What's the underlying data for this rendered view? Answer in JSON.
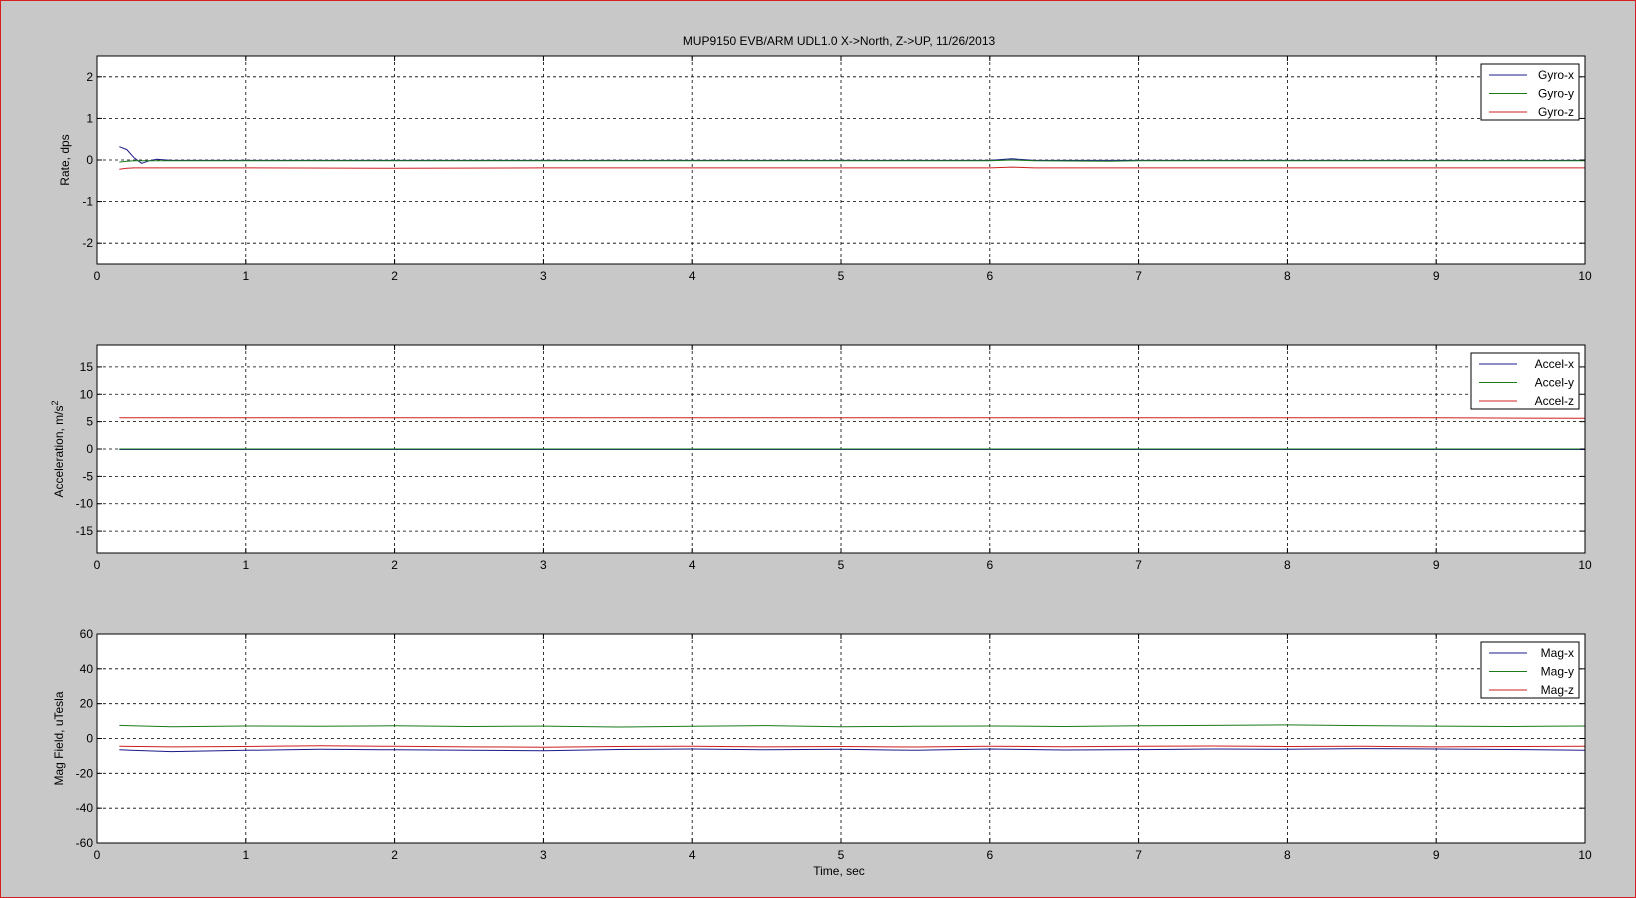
{
  "figure": {
    "title": "MUP9150 EVB/ARM UDL1.0 X->North, Z->UP, 11/26/2013",
    "xlabel": "Time, sec"
  },
  "colors": {
    "background": "#c8c8c8",
    "axes_background": "#ffffff",
    "x_series": "#1a1a8c",
    "y_series": "#1a7a1a",
    "z_series": "#cc2020",
    "window_border": "#d42020"
  },
  "chart_data": [
    {
      "type": "line",
      "ylabel": "Rate, dps",
      "xlim": [
        0,
        10
      ],
      "ylim": [
        -2.5,
        2.5
      ],
      "xticks": [
        0,
        1,
        2,
        3,
        4,
        5,
        6,
        7,
        8,
        9,
        10
      ],
      "yticks": [
        -2,
        -1,
        0,
        1,
        2
      ],
      "grid": true,
      "legend_position": "top-right",
      "x": [
        0.15,
        0.2,
        0.25,
        0.3,
        0.35,
        0.4,
        0.5,
        1.0,
        2.0,
        3.0,
        4.0,
        5.0,
        6.0,
        6.15,
        6.3,
        6.8,
        7.0,
        8.0,
        9.0,
        10.0
      ],
      "series": [
        {
          "name": "Gyro-x",
          "color": "#1a1a8c",
          "values": [
            0.32,
            0.25,
            0.05,
            -0.08,
            -0.02,
            0.02,
            -0.01,
            -0.01,
            -0.01,
            -0.01,
            -0.01,
            -0.01,
            -0.01,
            0.03,
            -0.01,
            -0.01,
            -0.01,
            -0.01,
            -0.01,
            -0.01
          ]
        },
        {
          "name": "Gyro-y",
          "color": "#1a7a1a",
          "values": [
            -0.05,
            -0.03,
            -0.02,
            -0.02,
            -0.02,
            -0.02,
            -0.02,
            -0.02,
            -0.02,
            -0.02,
            -0.02,
            -0.02,
            -0.02,
            0.0,
            -0.02,
            -0.03,
            -0.02,
            -0.02,
            -0.02,
            -0.02
          ]
        },
        {
          "name": "Gyro-z",
          "color": "#cc2020",
          "values": [
            -0.22,
            -0.2,
            -0.19,
            -0.19,
            -0.19,
            -0.19,
            -0.19,
            -0.19,
            -0.2,
            -0.19,
            -0.19,
            -0.19,
            -0.19,
            -0.17,
            -0.19,
            -0.19,
            -0.19,
            -0.19,
            -0.19,
            -0.19
          ]
        }
      ]
    },
    {
      "type": "line",
      "ylabel": "Acceleration, m/s",
      "ylabel_superscript": "2",
      "xlim": [
        0,
        10
      ],
      "ylim": [
        -19,
        19
      ],
      "xticks": [
        0,
        1,
        2,
        3,
        4,
        5,
        6,
        7,
        8,
        9,
        10
      ],
      "yticks": [
        -15,
        -10,
        -5,
        0,
        5,
        10,
        15
      ],
      "grid": true,
      "legend_position": "top-right",
      "x": [
        0.15,
        1.0,
        2.0,
        3.0,
        4.0,
        5.0,
        6.0,
        7.0,
        8.0,
        9.0,
        10.0
      ],
      "series": [
        {
          "name": "Accel-x",
          "color": "#1a1a8c",
          "values": [
            -0.1,
            -0.1,
            -0.1,
            -0.1,
            -0.1,
            -0.1,
            -0.1,
            -0.1,
            -0.1,
            -0.1,
            -0.1
          ]
        },
        {
          "name": "Accel-y",
          "color": "#1a7a1a",
          "values": [
            0.0,
            0.0,
            0.0,
            0.0,
            0.0,
            0.0,
            0.0,
            0.0,
            0.0,
            0.0,
            0.0
          ]
        },
        {
          "name": "Accel-z",
          "color": "#cc2020",
          "values": [
            5.7,
            5.7,
            5.7,
            5.7,
            5.7,
            5.7,
            5.7,
            5.7,
            5.7,
            5.7,
            5.6
          ]
        }
      ]
    },
    {
      "type": "line",
      "ylabel": "Mag Field, uTesla",
      "xlim": [
        0,
        10
      ],
      "ylim": [
        -60,
        60
      ],
      "xticks": [
        0,
        1,
        2,
        3,
        4,
        5,
        6,
        7,
        8,
        9,
        10
      ],
      "yticks": [
        -60,
        -40,
        -20,
        0,
        20,
        40,
        60
      ],
      "grid": true,
      "legend_position": "top-right",
      "x": [
        0.15,
        0.5,
        1.0,
        1.5,
        2.0,
        2.5,
        3.0,
        3.5,
        4.0,
        4.5,
        5.0,
        5.5,
        6.0,
        6.5,
        7.0,
        7.5,
        8.0,
        8.5,
        9.0,
        9.5,
        10.0
      ],
      "series": [
        {
          "name": "Mag-x",
          "color": "#1a1a8c",
          "values": [
            -6.5,
            -7.5,
            -6.8,
            -6.2,
            -6.5,
            -6.8,
            -7.0,
            -6.3,
            -6.0,
            -6.5,
            -6.2,
            -6.8,
            -6.0,
            -6.6,
            -6.4,
            -6.0,
            -6.2,
            -5.8,
            -6.0,
            -6.3,
            -6.8
          ]
        },
        {
          "name": "Mag-y",
          "color": "#1a7a1a",
          "values": [
            7.5,
            6.8,
            7.2,
            7.0,
            7.3,
            6.9,
            7.1,
            6.6,
            7.0,
            7.4,
            6.8,
            7.0,
            7.2,
            6.9,
            7.3,
            7.5,
            7.8,
            7.4,
            7.1,
            6.9,
            7.2
          ]
        },
        {
          "name": "Mag-z",
          "color": "#cc2020",
          "values": [
            -4.5,
            -4.8,
            -4.6,
            -4.2,
            -4.5,
            -4.8,
            -5.0,
            -4.6,
            -4.4,
            -4.8,
            -4.6,
            -4.9,
            -4.4,
            -4.7,
            -4.5,
            -4.3,
            -4.6,
            -4.5,
            -4.8,
            -4.6,
            -4.4
          ]
        }
      ]
    }
  ]
}
